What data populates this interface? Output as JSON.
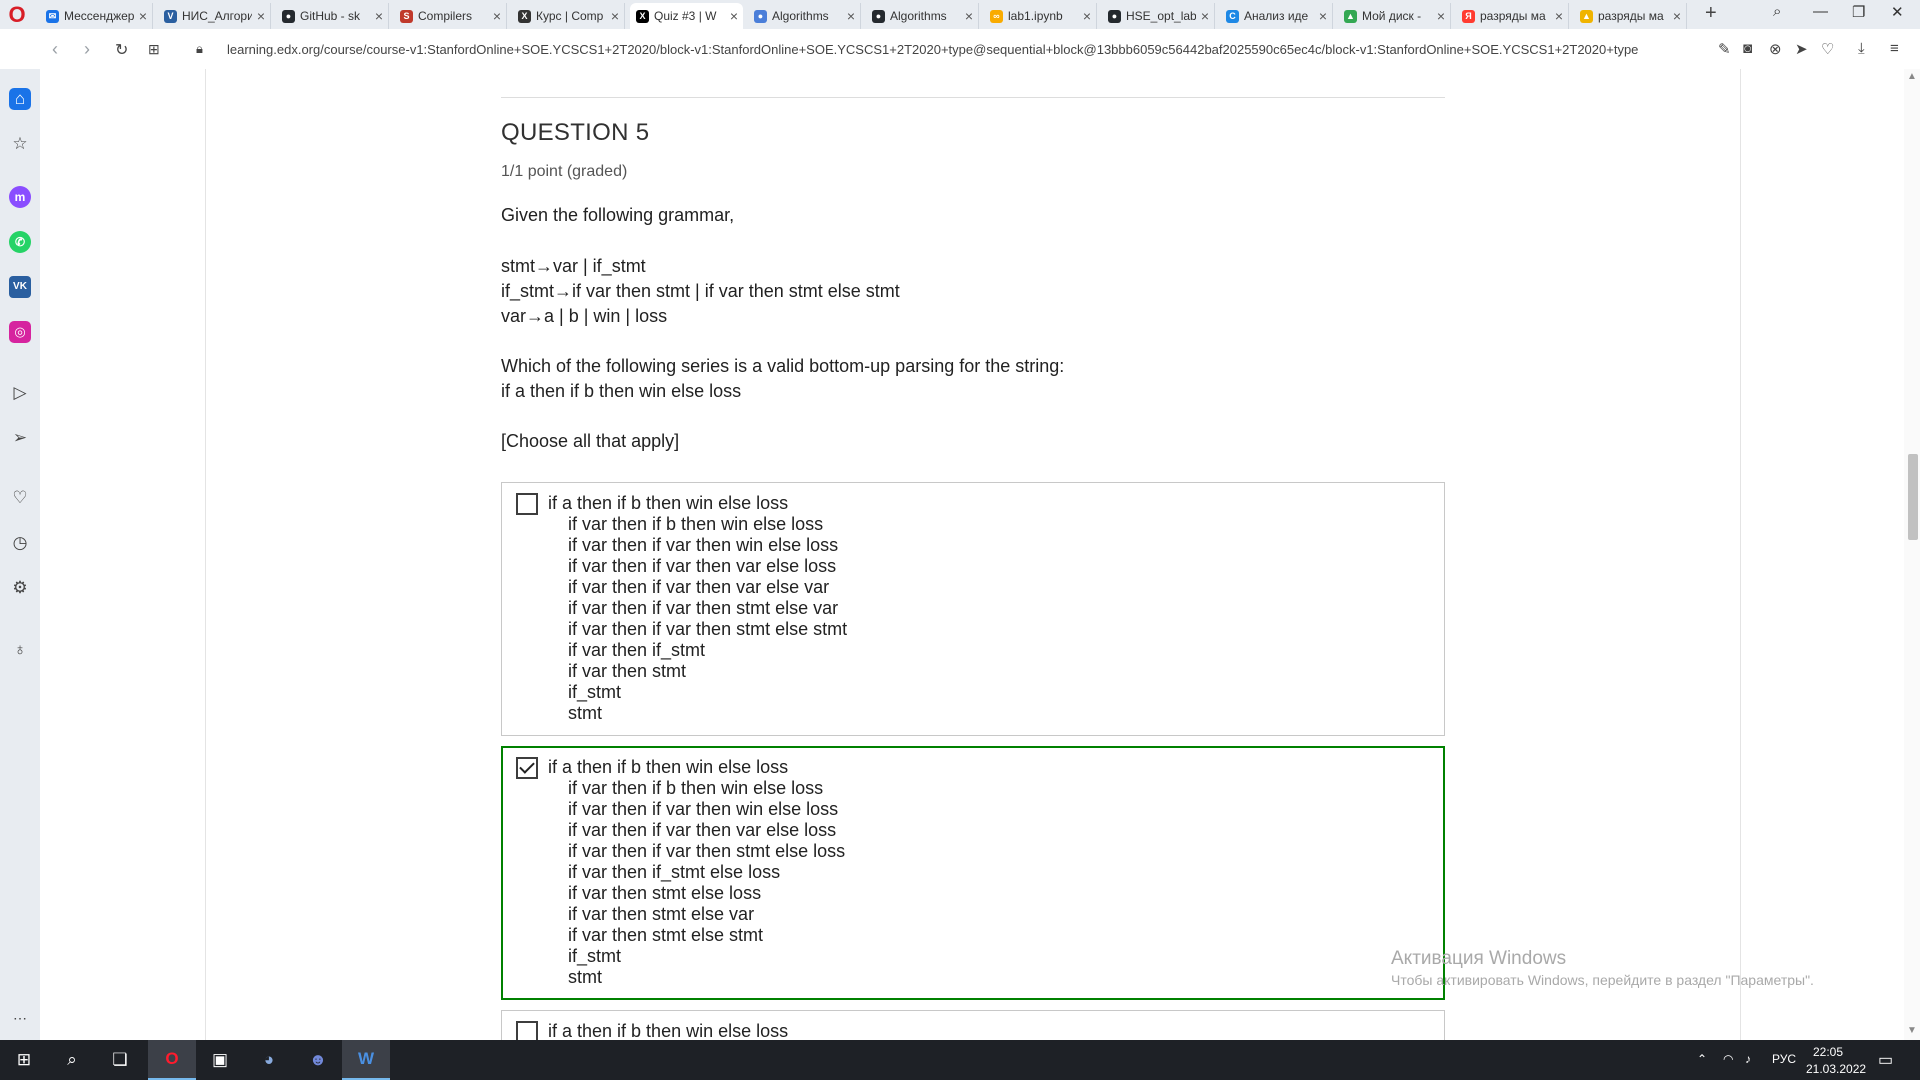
{
  "browser": {
    "tabs": [
      {
        "title": "Мессенджер",
        "color": "#1a73e8",
        "glyph": "✉"
      },
      {
        "title": "НИС_Алгоритмы",
        "color": "#2a5fa0",
        "glyph": "V"
      },
      {
        "title": "GitHub - sk",
        "color": "#24292e",
        "glyph": "●"
      },
      {
        "title": "Compilers",
        "color": "#c0392b",
        "glyph": "S"
      },
      {
        "title": "Курс | Comp",
        "color": "#333333",
        "glyph": "X"
      },
      {
        "title": "Quiz #3 | W",
        "color": "#000000",
        "glyph": "X"
      },
      {
        "title": "Algorithms",
        "color": "#4a7ed9",
        "glyph": "●"
      },
      {
        "title": "Algorithms",
        "color": "#24292e",
        "glyph": "●"
      },
      {
        "title": "lab1.ipynb",
        "color": "#f9ab00",
        "glyph": "∞"
      },
      {
        "title": "HSE_opt_lab",
        "color": "#24292e",
        "glyph": "●"
      },
      {
        "title": "Анализ иде",
        "color": "#1e88e5",
        "glyph": "C"
      },
      {
        "title": "Мой диск -",
        "color": "#34a853",
        "glyph": "▲"
      },
      {
        "title": "разряды ма",
        "color": "#ff3b30",
        "glyph": "Я"
      },
      {
        "title": "разряды ма",
        "color": "#f0b400",
        "glyph": "▲"
      }
    ],
    "active_tab_index": 5,
    "url": "learning.edx.org/course/course-v1:StanfordOnline+SOE.YCSCS1+2T2020/block-v1:StanfordOnline+SOE.YCSCS1+2T2020+type@sequential+block@13bbb6059c56442baf2025590c65ec4c/block-v1:StanfordOnline+SOE.YCSCS1+2T2020+type"
  },
  "question": {
    "title": "QUESTION 5",
    "points": "1/1 point (graded)",
    "intro": "Given the following grammar,",
    "grammar": [
      "stmt→var | if_stmt",
      "if_stmt→if var then stmt | if var then stmt else stmt",
      "var→a | b | win | loss"
    ],
    "prompt_line1": "Which of the following series is a valid bottom-up parsing for the string:",
    "prompt_line2": "if a then if b then win else loss",
    "instruction": "[Choose all that apply]"
  },
  "choices": [
    {
      "checked": false,
      "lines": [
        "if a then if b then win else loss",
        "if var then if b then win else loss",
        "if var then if var then win else loss",
        "if var then if var then var else loss",
        "if var then if var then var else var",
        "if var then if var then stmt else var",
        "if var then if var then stmt else stmt",
        "if var then if_stmt",
        "if var then stmt",
        "if_stmt",
        "stmt"
      ]
    },
    {
      "checked": true,
      "lines": [
        "if a then if b then win else loss",
        "if var then if b then win else loss",
        "if var then if var then win else loss",
        "if var then if var then var else loss",
        "if var then if var then stmt else loss",
        "if var then if_stmt else loss",
        "if var then stmt else loss",
        "if var then stmt else var",
        "if var then stmt else stmt",
        "if_stmt",
        "stmt"
      ]
    },
    {
      "checked": false,
      "lines": [
        "if a then if b then win else loss"
      ]
    }
  ],
  "watermark": {
    "title": "Активация Windows",
    "subtitle": "Чтобы активировать Windows, перейдите в раздел \"Параметры\"."
  },
  "taskbar": {
    "language": "РУС",
    "time": "22:05",
    "date": "21.03.2022"
  }
}
